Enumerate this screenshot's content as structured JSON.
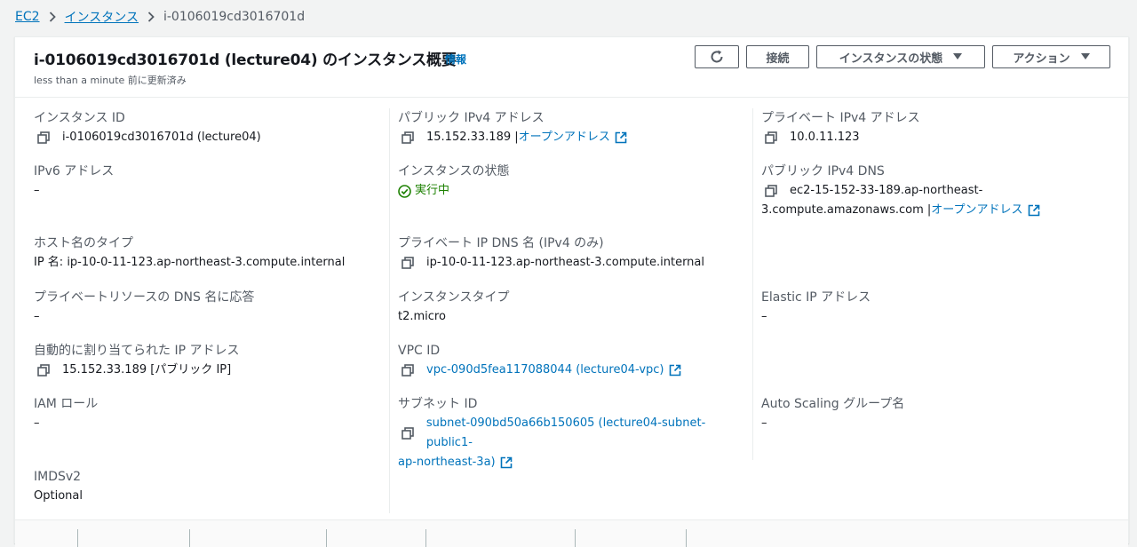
{
  "breadcrumb": {
    "root": "EC2",
    "section": "インスタンス",
    "current": "i-0106019cd3016701d"
  },
  "header": {
    "title": "i-0106019cd3016701d (lecture04) のインスタンス概要",
    "info": "情報",
    "updated": "less than a minute 前に更新済み"
  },
  "buttons": {
    "connect": "接続",
    "instance_state": "インスタンスの状態",
    "actions": "アクション"
  },
  "fields": {
    "instance_id": {
      "label": "インスタンス ID",
      "value": "i-0106019cd3016701d (lecture04)"
    },
    "public_ipv4": {
      "label": "パブリック IPv4 アドレス",
      "value": "15.152.33.189 |",
      "link": "オープンアドレス"
    },
    "private_ipv4": {
      "label": "プライベート IPv4 アドレス",
      "value": "10.0.11.123"
    },
    "ipv6": {
      "label": "IPv6 アドレス",
      "value": "–"
    },
    "instance_state": {
      "label": "インスタンスの状態",
      "value": "実行中"
    },
    "public_dns": {
      "label": "パブリック IPv4 DNS",
      "value_line1": "ec2-15-152-33-189.ap-northeast-",
      "value_line2": "3.compute.amazonaws.com |",
      "link": "オープンアドレス"
    },
    "hostname_type": {
      "label": "ホスト名のタイプ",
      "value": "IP 名: ip-10-0-11-123.ap-northeast-3.compute.internal"
    },
    "private_dns": {
      "label": "プライベート IP DNS 名 (IPv4 のみ)",
      "value": "ip-10-0-11-123.ap-northeast-3.compute.internal"
    },
    "private_resource_dns": {
      "label": "プライベートリソースの DNS 名に応答",
      "value": "–"
    },
    "instance_type": {
      "label": "インスタンスタイプ",
      "value": "t2.micro"
    },
    "elastic_ip": {
      "label": "Elastic IP アドレス",
      "value": "–"
    },
    "auto_ip": {
      "label": "自動的に割り当てられた IP アドレス",
      "value": "15.152.33.189 [パブリック IP]"
    },
    "vpc_id": {
      "label": "VPC ID",
      "value": "vpc-090d5fea117088044 (lecture04-vpc)"
    },
    "iam_role": {
      "label": "IAM ロール",
      "value": "–"
    },
    "subnet_id": {
      "label": "サブネット ID",
      "value_line1": "subnet-090bd50a66b150605 (lecture04-subnet-public1-",
      "value_line2": "ap-northeast-3a)"
    },
    "asg_name": {
      "label": "Auto Scaling グループ名",
      "value": "–"
    },
    "imdsv2": {
      "label": "IMDSv2",
      "value": "Optional"
    }
  },
  "icons": {
    "copy": "copy-icon",
    "external": "external-link-icon",
    "refresh": "refresh-icon",
    "status": "check-circle-icon",
    "caret": "caret-down-icon"
  },
  "colors": {
    "link": "#0073bb",
    "running": "#1d8102",
    "label": "#545b64"
  }
}
